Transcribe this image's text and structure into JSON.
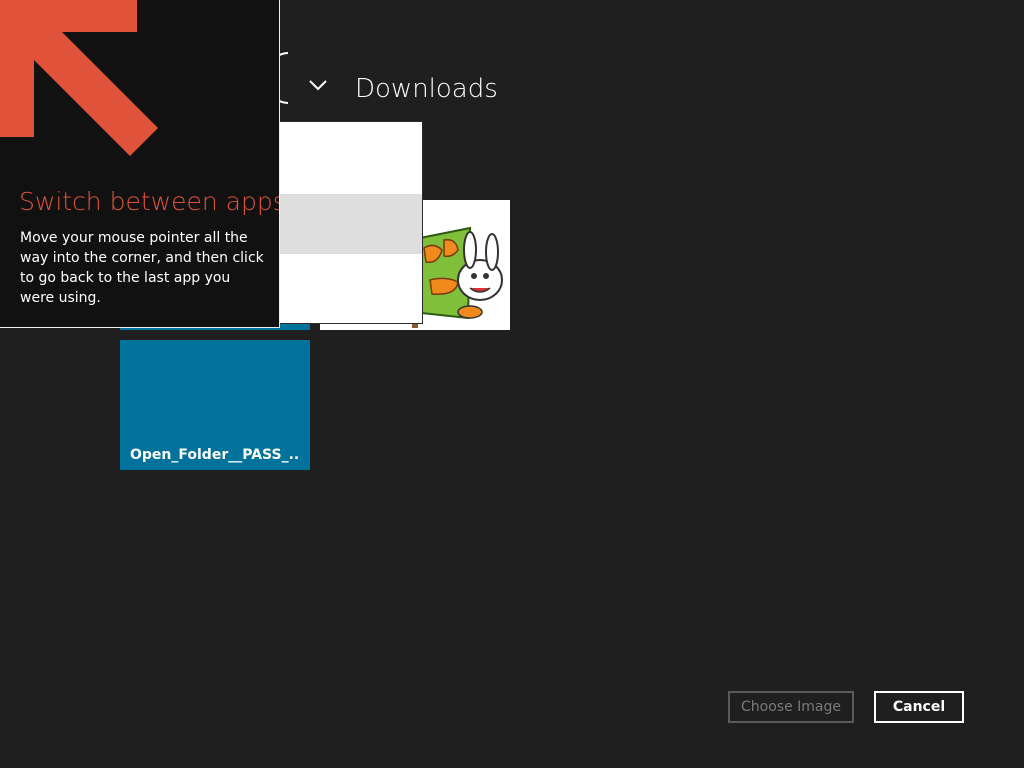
{
  "header": {
    "location_title": "Downloads",
    "chevron_icon": "chevron-down-icon"
  },
  "location_menu": {
    "selected_index": 1
  },
  "files": [
    {
      "type": "folder",
      "label": "",
      "color": "#00729c"
    },
    {
      "type": "image",
      "label": ""
    },
    {
      "type": "folder",
      "label": "Open_Folder__PASS_...",
      "color": "#00729c"
    }
  ],
  "tip": {
    "title": "Switch between apps",
    "body": "Move your mouse pointer all the way into the corner, and then click to go back to the last app you were using.",
    "arrow_icon": "corner-arrow-icon",
    "accent_color": "#e0533a"
  },
  "buttons": {
    "choose_label": "Choose Image",
    "choose_disabled": true,
    "cancel_label": "Cancel"
  }
}
